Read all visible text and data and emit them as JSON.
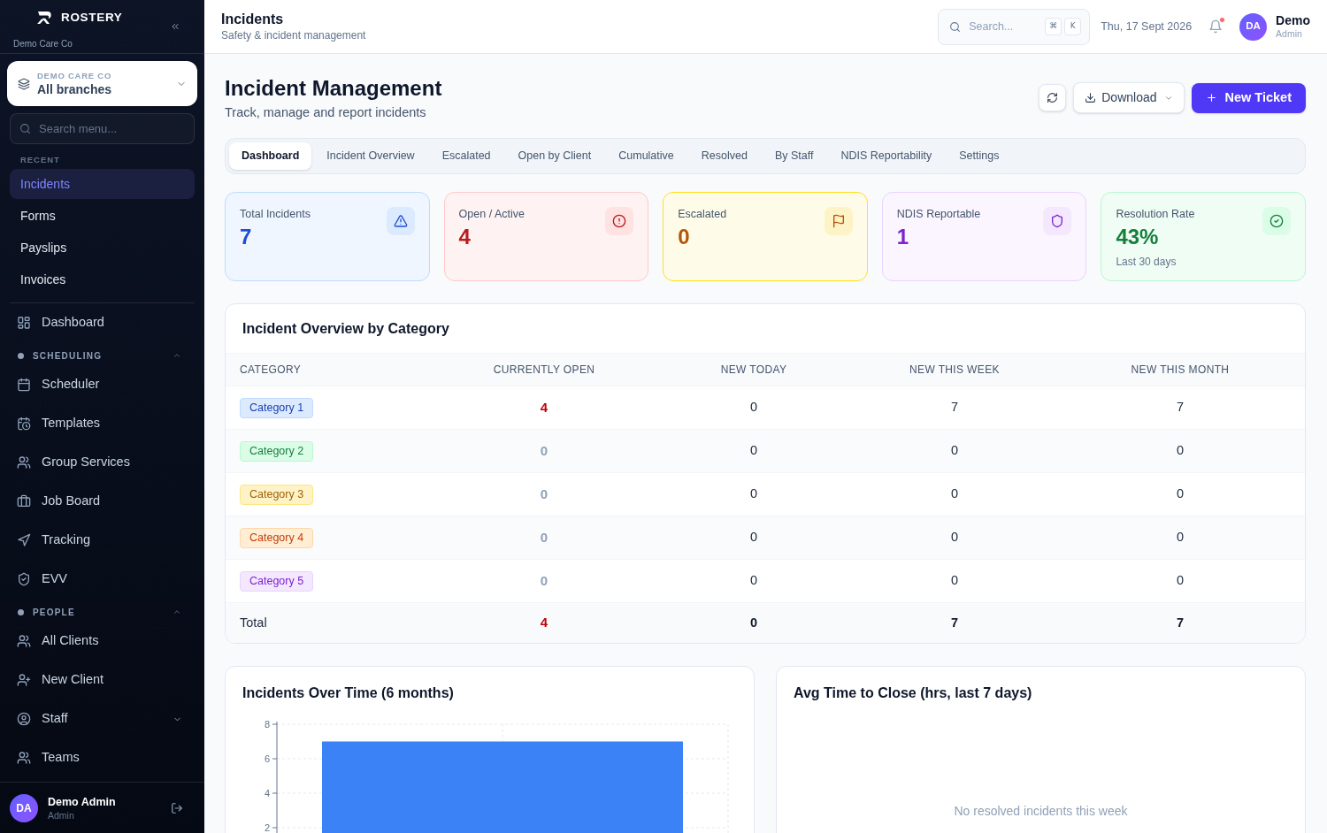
{
  "sidebar": {
    "brand": "ROSTERY",
    "org": "Demo Care Co",
    "branch": {
      "label": "DEMO CARE CO",
      "value": "All branches"
    },
    "search": {
      "placeholder": "Search menu..."
    },
    "recent": {
      "heading": "RECENT",
      "items": [
        {
          "label": "Incidents",
          "selected": true
        },
        {
          "label": "Forms",
          "selected": false
        },
        {
          "label": "Payslips",
          "selected": false
        },
        {
          "label": "Invoices",
          "selected": false
        }
      ]
    },
    "nav": [
      {
        "kind": "link",
        "label": "Dashboard",
        "selected": false
      },
      {
        "kind": "section",
        "label": "SCHEDULING",
        "expanded": true,
        "children": [
          {
            "label": "Scheduler",
            "selected": false
          },
          {
            "label": "Templates",
            "selected": false
          },
          {
            "label": "Group Services",
            "selected": false
          },
          {
            "label": "Job Board",
            "selected": false
          },
          {
            "label": "Tracking",
            "selected": false
          },
          {
            "label": "EVV",
            "selected": false
          }
        ]
      },
      {
        "kind": "section",
        "label": "PEOPLE",
        "expanded": true,
        "children": [
          {
            "label": "All Clients",
            "selected": false
          },
          {
            "label": "New Client",
            "selected": false
          },
          {
            "label": "Staff",
            "selected": false,
            "expanded": false
          },
          {
            "label": "Teams",
            "selected": false
          }
        ]
      }
    ],
    "user": {
      "initials": "DA",
      "name": "Demo Admin",
      "role": "Admin"
    }
  },
  "topbar": {
    "title": "Incidents",
    "subtitle": "Safety & incident management",
    "search": {
      "placeholder": "Search...",
      "shortcut": [
        "⌘",
        "K"
      ]
    },
    "date": "Thu, 17 Sept 2026",
    "notifications": {
      "unread": true
    },
    "user": {
      "initials": "DA",
      "name": "Demo",
      "role": "Admin"
    }
  },
  "page": {
    "title": "Incident Management",
    "subtitle": "Track, manage and report incidents",
    "actions": [
      {
        "kind": "secondary",
        "label": "Download"
      },
      {
        "kind": "primary",
        "label": "New Ticket"
      }
    ],
    "tabs": [
      {
        "label": "Dashboard",
        "selected": true
      },
      {
        "label": "Incident Overview",
        "selected": false
      },
      {
        "label": "Escalated",
        "selected": false
      },
      {
        "label": "Open by Client",
        "selected": false
      },
      {
        "label": "Cumulative",
        "selected": false
      },
      {
        "label": "Resolved",
        "selected": false
      },
      {
        "label": "By Staff",
        "selected": false
      },
      {
        "label": "NDIS Reportability",
        "selected": false
      },
      {
        "label": "Settings",
        "selected": false
      }
    ],
    "stats": [
      {
        "label": "Total Incidents",
        "value": "7",
        "color": "#1d4ed8"
      },
      {
        "label": "Open / Active",
        "value": "4",
        "color": "#b91c1c"
      },
      {
        "label": "Escalated",
        "value": "0",
        "color": "#b45309"
      },
      {
        "label": "NDIS Reportable",
        "value": "1",
        "color": "#7e22ce"
      },
      {
        "label": "Resolution Rate",
        "value": "43%",
        "note": "Last 30 days",
        "color": "#15803d"
      }
    ]
  },
  "category_table": {
    "title": "Incident Overview by Category",
    "columns": [
      "CATEGORY",
      "CURRENTLY OPEN",
      "NEW TODAY",
      "NEW THIS WEEK",
      "NEW THIS MONTH"
    ],
    "rows": [
      {
        "category": {
          "label": "Category 1",
          "color": "#1e40af"
        },
        "currently_open": "4",
        "open_highlighted": true,
        "new_today": "0",
        "new_this_week": "7",
        "new_this_month": "7"
      },
      {
        "category": {
          "label": "Category 2",
          "color": "#15803d"
        },
        "currently_open": "0",
        "open_highlighted": false,
        "new_today": "0",
        "new_this_week": "0",
        "new_this_month": "0"
      },
      {
        "category": {
          "label": "Category 3",
          "color": "#a16207"
        },
        "currently_open": "0",
        "open_highlighted": false,
        "new_today": "0",
        "new_this_week": "0",
        "new_this_month": "0"
      },
      {
        "category": {
          "label": "Category 4",
          "color": "#c2410c"
        },
        "currently_open": "0",
        "open_highlighted": false,
        "new_today": "0",
        "new_this_week": "0",
        "new_this_month": "0"
      },
      {
        "category": {
          "label": "Category 5",
          "color": "#7e22ce"
        },
        "currently_open": "0",
        "open_highlighted": false,
        "new_today": "0",
        "new_this_week": "0",
        "new_this_month": "0"
      }
    ],
    "total": {
      "label": "Total",
      "currently_open": "4",
      "open_highlighted": true,
      "new_today": "0",
      "new_this_week": "7",
      "new_this_month": "7"
    }
  },
  "incidents_over_time": {
    "chart_data": {
      "type": "bar",
      "title": "Incidents Over Time (6 months)",
      "values": [
        7
      ],
      "ylim": [
        0,
        8
      ],
      "yticks": [
        2,
        4,
        6,
        8
      ],
      "grid": true
    }
  },
  "avg_time_to_close": {
    "title": "Avg Time to Close (hrs, last 7 days)",
    "empty_message": "No resolved incidents this week"
  }
}
